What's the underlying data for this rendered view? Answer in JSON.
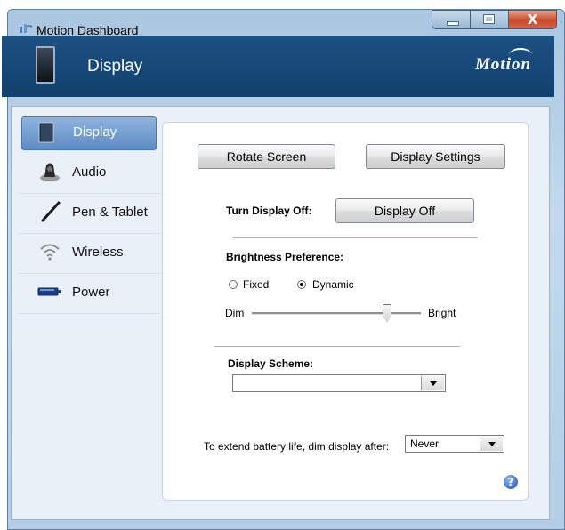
{
  "window": {
    "title": "Motion Dashboard",
    "close_glyph": "X"
  },
  "header": {
    "title": "Display",
    "logo": "Motion"
  },
  "sidebar": {
    "items": [
      {
        "label": "Display",
        "icon": "tablet-icon",
        "active": true
      },
      {
        "label": "Audio",
        "icon": "speaker-icon"
      },
      {
        "label": "Pen & Tablet",
        "icon": "pen-icon"
      },
      {
        "label": "Wireless",
        "icon": "wireless-icon"
      },
      {
        "label": "Power",
        "icon": "battery-icon"
      }
    ]
  },
  "panel": {
    "rotate_screen_label": "Rotate Screen",
    "display_settings_label": "Display Settings",
    "turn_display_off_label": "Turn Display Off:",
    "display_off_label": "Display Off",
    "brightness_label": "Brightness Preference:",
    "fixed_label": "Fixed",
    "dynamic_label": "Dynamic",
    "brightness_mode": "Dynamic",
    "dim_label": "Dim",
    "bright_label": "Bright",
    "brightness_level": 0.8,
    "display_scheme_label": "Display Scheme:",
    "display_scheme_value": "",
    "battery_label": "To extend battery life, dim display after:",
    "battery_value": "Never"
  },
  "help_glyph": "?"
}
